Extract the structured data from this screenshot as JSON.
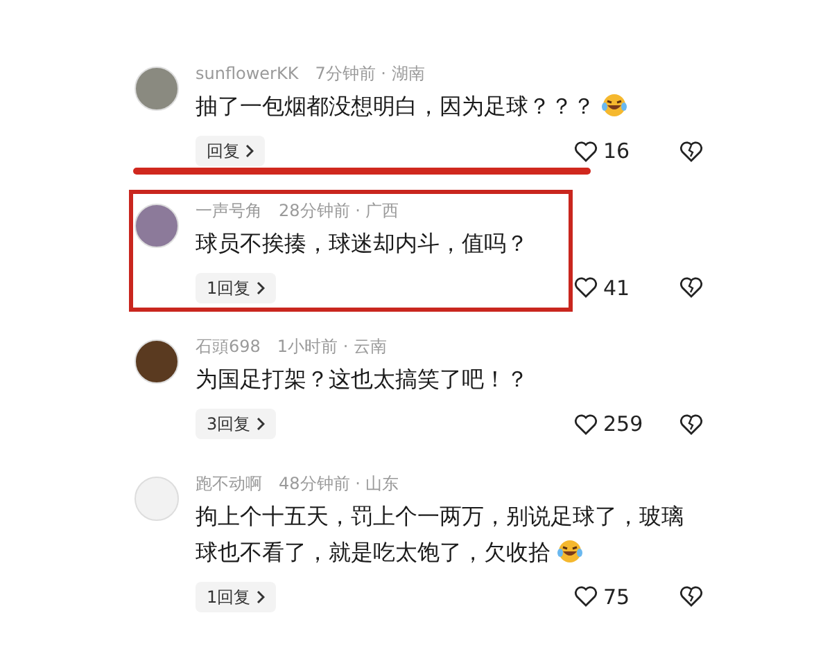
{
  "comments": [
    {
      "meta": "sunflowerKK　7分钟前 · 湖南",
      "text": "抽了一包烟都没想明白，因为足球？？？",
      "emoji": true,
      "replies": "回复",
      "likes": "16",
      "underlined": true,
      "boxed": false
    },
    {
      "meta": "一声号角　28分钟前 · 广西",
      "text": "球员不挨揍，球迷却内斗，值吗？",
      "emoji": false,
      "replies": "1回复",
      "likes": "41",
      "underlined": false,
      "boxed": true
    },
    {
      "meta": "石頭698　1小时前 · 云南",
      "text": "为国足打架？这也太搞笑了吧！？",
      "emoji": false,
      "replies": "3回复",
      "likes": "259",
      "underlined": false,
      "boxed": false
    },
    {
      "meta": "跑不动啊　48分钟前 · 山东",
      "text": "拘上个十五天，罚上个一两万，别说足球了，玻璃球也不看了，就是吃太饱了，欠收拾",
      "emoji": true,
      "replies": "1回复",
      "likes": "75",
      "underlined": false,
      "boxed": false
    }
  ]
}
